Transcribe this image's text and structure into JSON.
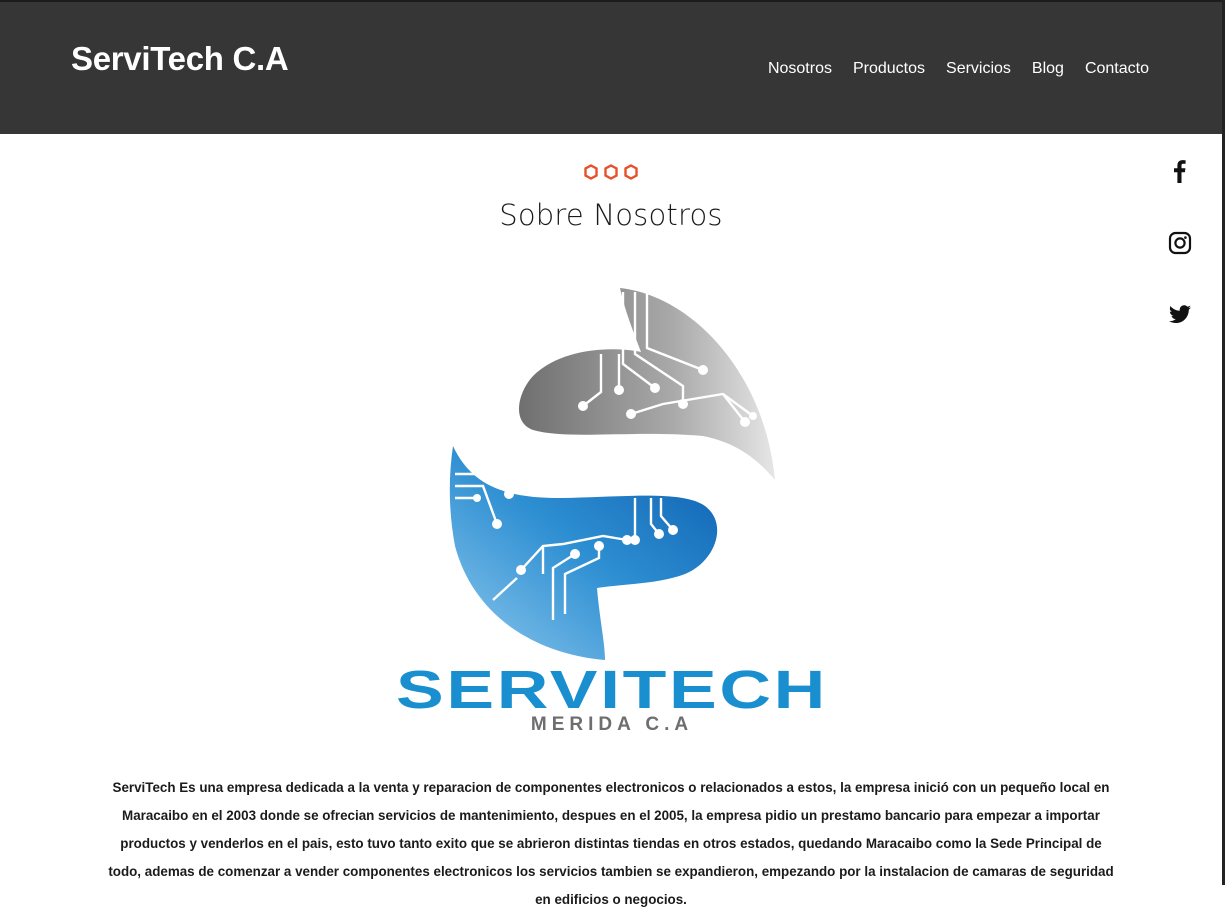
{
  "header": {
    "brand": "ServiTech C.A",
    "nav": [
      "Nosotros",
      "Productos",
      "Servicios",
      "Blog",
      "Contacto"
    ]
  },
  "section": {
    "title": "Sobre Nosotros",
    "paragraph": "ServiTech Es una empresa dedicada a la venta y reparacion de componentes electronicos o relacionados a estos, la empresa inició con un pequeño local en Maracaibo en el 2003 donde se ofrecian servicios de mantenimiento, despues en el 2005, la empresa pidio un prestamo bancario para empezar a importar productos y venderlos en el pais, esto tuvo tanto exito que se abrieron distintas tiendas en otros estados, quedando Maracaibo como la Sede Principal de todo, ademas de comenzar a vender componentes electronicos los servicios tambien se expandieron, empezando por la instalacion de camaras de seguridad en edificios o negocios."
  },
  "logo": {
    "wordmark": "SERVITECH",
    "subtitle": "MERIDA C.A"
  },
  "social": [
    "facebook-icon",
    "instagram-icon",
    "twitter-icon"
  ],
  "colors": {
    "header_bg": "#363636",
    "accent_dots": "#e8502a",
    "logo_blue": "#1a8fd0",
    "logo_gray": "#7a7a7a"
  }
}
